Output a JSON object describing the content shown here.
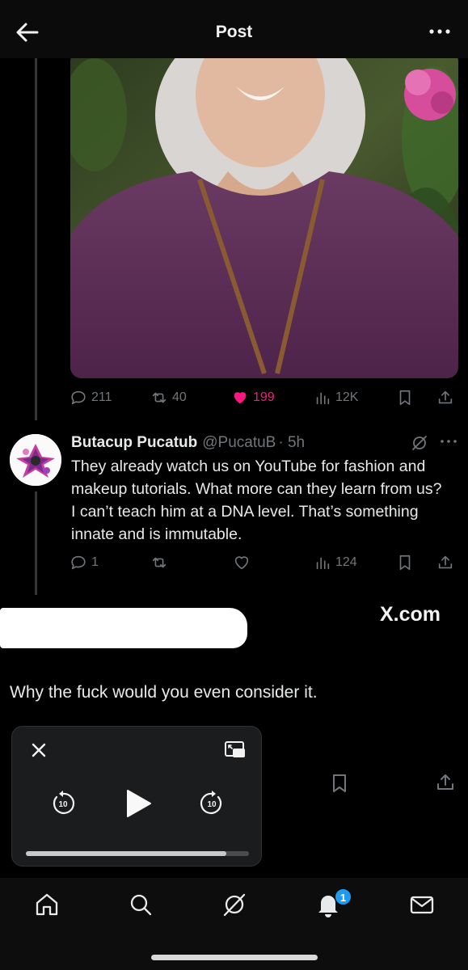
{
  "header": {
    "title": "Post",
    "back_icon": "back-arrow-icon",
    "more_icon": "more-dots-icon"
  },
  "original_post": {
    "stats": {
      "replies": "211",
      "reposts": "40",
      "likes": "199",
      "views": "12K"
    },
    "like_color": "#f91880"
  },
  "reply": {
    "display_name": "Butacup Pucatub",
    "handle": "@PucatuB",
    "time": "· 5h",
    "text": "They already watch us on YouTube for fashion and makeup tutorials. What more can they learn from us? I can’t teach him at a DNA level. That’s something innate and is immutable.",
    "stats": {
      "replies": "1",
      "reposts": "",
      "likes": "",
      "views": "124"
    }
  },
  "watermark": "X.com",
  "quote_text": "Why the fuck would you even consider it.",
  "mini_player": {
    "progress": 0.9,
    "rewind_seconds": "10",
    "forward_seconds": "10"
  },
  "tabbar": {
    "notification_count": "1"
  },
  "colors": {
    "muted": "#71767b",
    "accent": "#1d9bf0",
    "background": "#000000"
  }
}
